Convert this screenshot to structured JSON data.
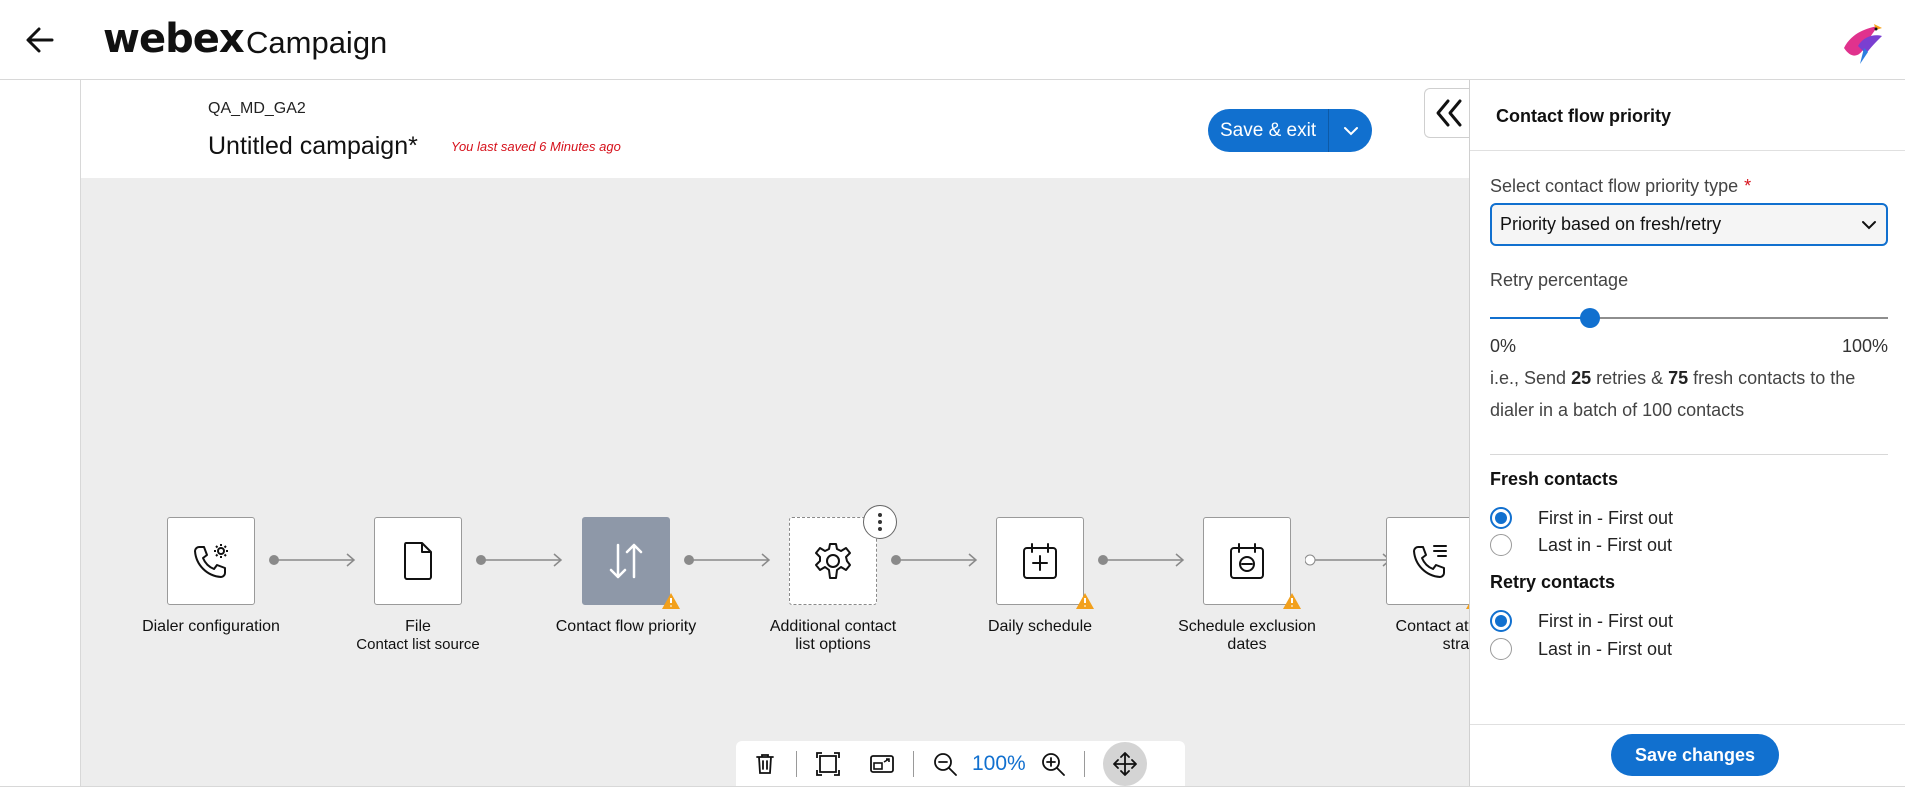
{
  "header": {
    "brand": "webex",
    "app_name": "Campaign",
    "back_icon": "arrow-left-icon",
    "avatar_icon": "bird-avatar-icon"
  },
  "campaign": {
    "id": "QA_MD_GA2",
    "name": "Untitled campaign*",
    "saved_note": "You last saved 6 Minutes ago",
    "save_label": "Save & exit"
  },
  "flow": {
    "nodes": [
      {
        "icon": "phone-settings-icon",
        "label": "Dialer configuration",
        "sub": "",
        "warning": false
      },
      {
        "icon": "file-icon",
        "label": "File",
        "sub": "Contact list source",
        "warning": false
      },
      {
        "icon": "arrows-up-down-icon",
        "label": "Contact flow priority",
        "sub": "",
        "warning": true
      },
      {
        "icon": "gear-icon",
        "label": "Additional contact list options",
        "sub": "",
        "warning": false
      },
      {
        "icon": "calendar-add-icon",
        "label": "Daily schedule",
        "sub": "",
        "warning": true
      },
      {
        "icon": "calendar-minus-icon",
        "label": "Schedule exclusion dates",
        "sub": "",
        "warning": true
      },
      {
        "icon": "phone-list-icon",
        "label": "Contact attempts stra",
        "sub": "",
        "warning": true
      }
    ]
  },
  "toolbar": {
    "zoom": "100%"
  },
  "panel": {
    "title": "Contact flow priority",
    "select_label": "Select contact flow priority type",
    "required_mark": "*",
    "select_value": "Priority based on fresh/retry",
    "retry_label": "Retry percentage",
    "retry_value": 25,
    "range_min": "0%",
    "range_max": "100%",
    "explain_prefix": "i.e., Send ",
    "explain_retries": "25",
    "explain_mid": " retries & ",
    "explain_fresh": "75",
    "explain_suffix": " fresh contacts to the dialer in a batch of 100 contacts",
    "fresh_title": "Fresh contacts",
    "fresh_options": [
      "First in - First out",
      "Last in - First out"
    ],
    "fresh_selected": 0,
    "retry_title": "Retry contacts",
    "retry_options": [
      "First in - First out",
      "Last in - First out"
    ],
    "retry_selected": 0,
    "save_changes": "Save changes"
  },
  "colors": {
    "accent": "#1170cf",
    "warning": "#f2a01c",
    "saved_note": "#d6111b",
    "active_node": "#8e98a8",
    "canvas": "#ededed"
  }
}
